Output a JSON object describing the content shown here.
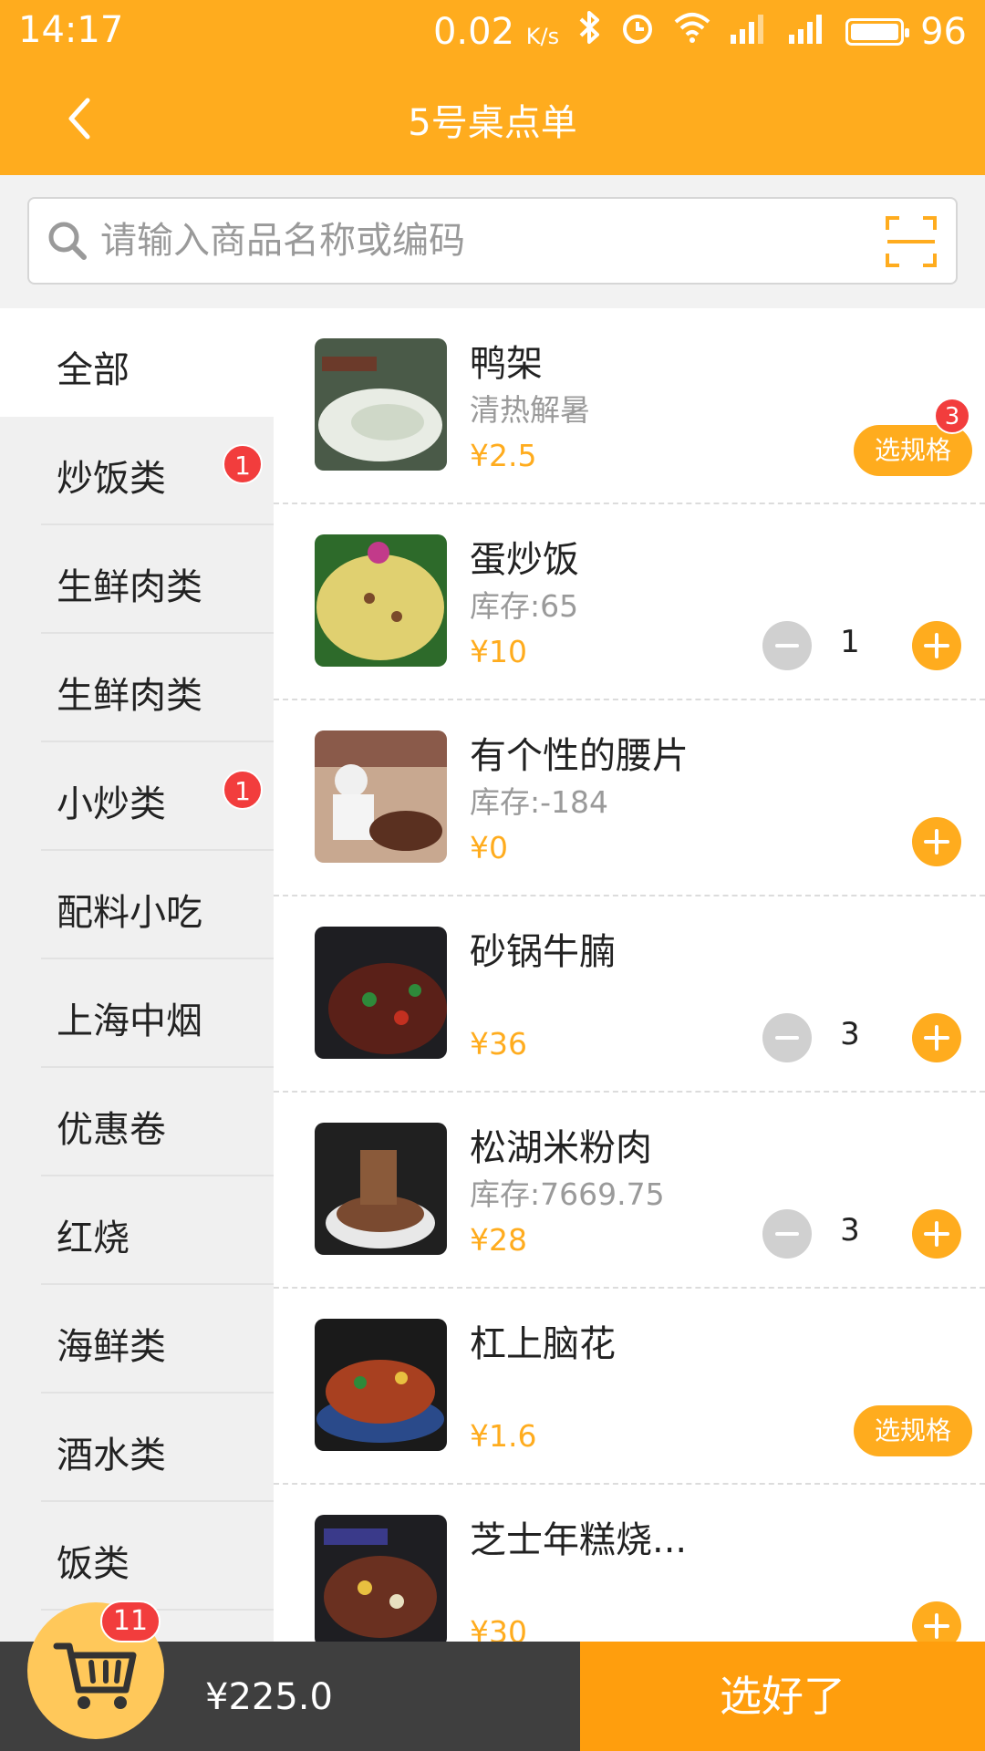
{
  "status_bar": {
    "time": "14:17",
    "speed": "0.02",
    "speed_unit": "K/s",
    "battery": "96"
  },
  "header": {
    "title": "5号桌点单"
  },
  "search": {
    "placeholder": "请输入商品名称或编码"
  },
  "sidebar": {
    "items": [
      {
        "label": "全部",
        "badge": ""
      },
      {
        "label": "炒饭类",
        "badge": "1"
      },
      {
        "label": "生鲜肉类",
        "badge": ""
      },
      {
        "label": "生鲜肉类",
        "badge": ""
      },
      {
        "label": "小炒类",
        "badge": "1"
      },
      {
        "label": "配料小吃",
        "badge": ""
      },
      {
        "label": "上海中烟",
        "badge": ""
      },
      {
        "label": "优惠卷",
        "badge": ""
      },
      {
        "label": "红烧",
        "badge": ""
      },
      {
        "label": "海鲜类",
        "badge": ""
      },
      {
        "label": "酒水类",
        "badge": ""
      },
      {
        "label": "饭类",
        "badge": ""
      }
    ]
  },
  "products": [
    {
      "name": "鸭架",
      "sub": "清热解暑",
      "price": "¥2.5",
      "spec_label": "选规格",
      "spec_badge": "3"
    },
    {
      "name": "蛋炒饭",
      "sub": "库存:65",
      "price": "¥10",
      "qty": "1"
    },
    {
      "name": "有个性的腰片",
      "sub": "库存:-184",
      "price": "¥0"
    },
    {
      "name": "砂锅牛腩",
      "sub": "",
      "price": "¥36",
      "qty": "3"
    },
    {
      "name": "松湖米粉肉",
      "sub": "库存:7669.75",
      "price": "¥28",
      "qty": "3"
    },
    {
      "name": "杠上脑花",
      "sub": "",
      "price": "¥1.6",
      "spec_label": "选规格"
    },
    {
      "name": "芝士年糕烧...",
      "sub": "",
      "price": "¥30"
    }
  ],
  "bottom_bar": {
    "cart_count": "11",
    "total": "¥225.0",
    "confirm_label": "选好了"
  },
  "colors": {
    "primary": "#ffac1e",
    "badge": "#f23d3d",
    "dark": "#3f3f3f",
    "confirm": "#ff9e0d"
  }
}
